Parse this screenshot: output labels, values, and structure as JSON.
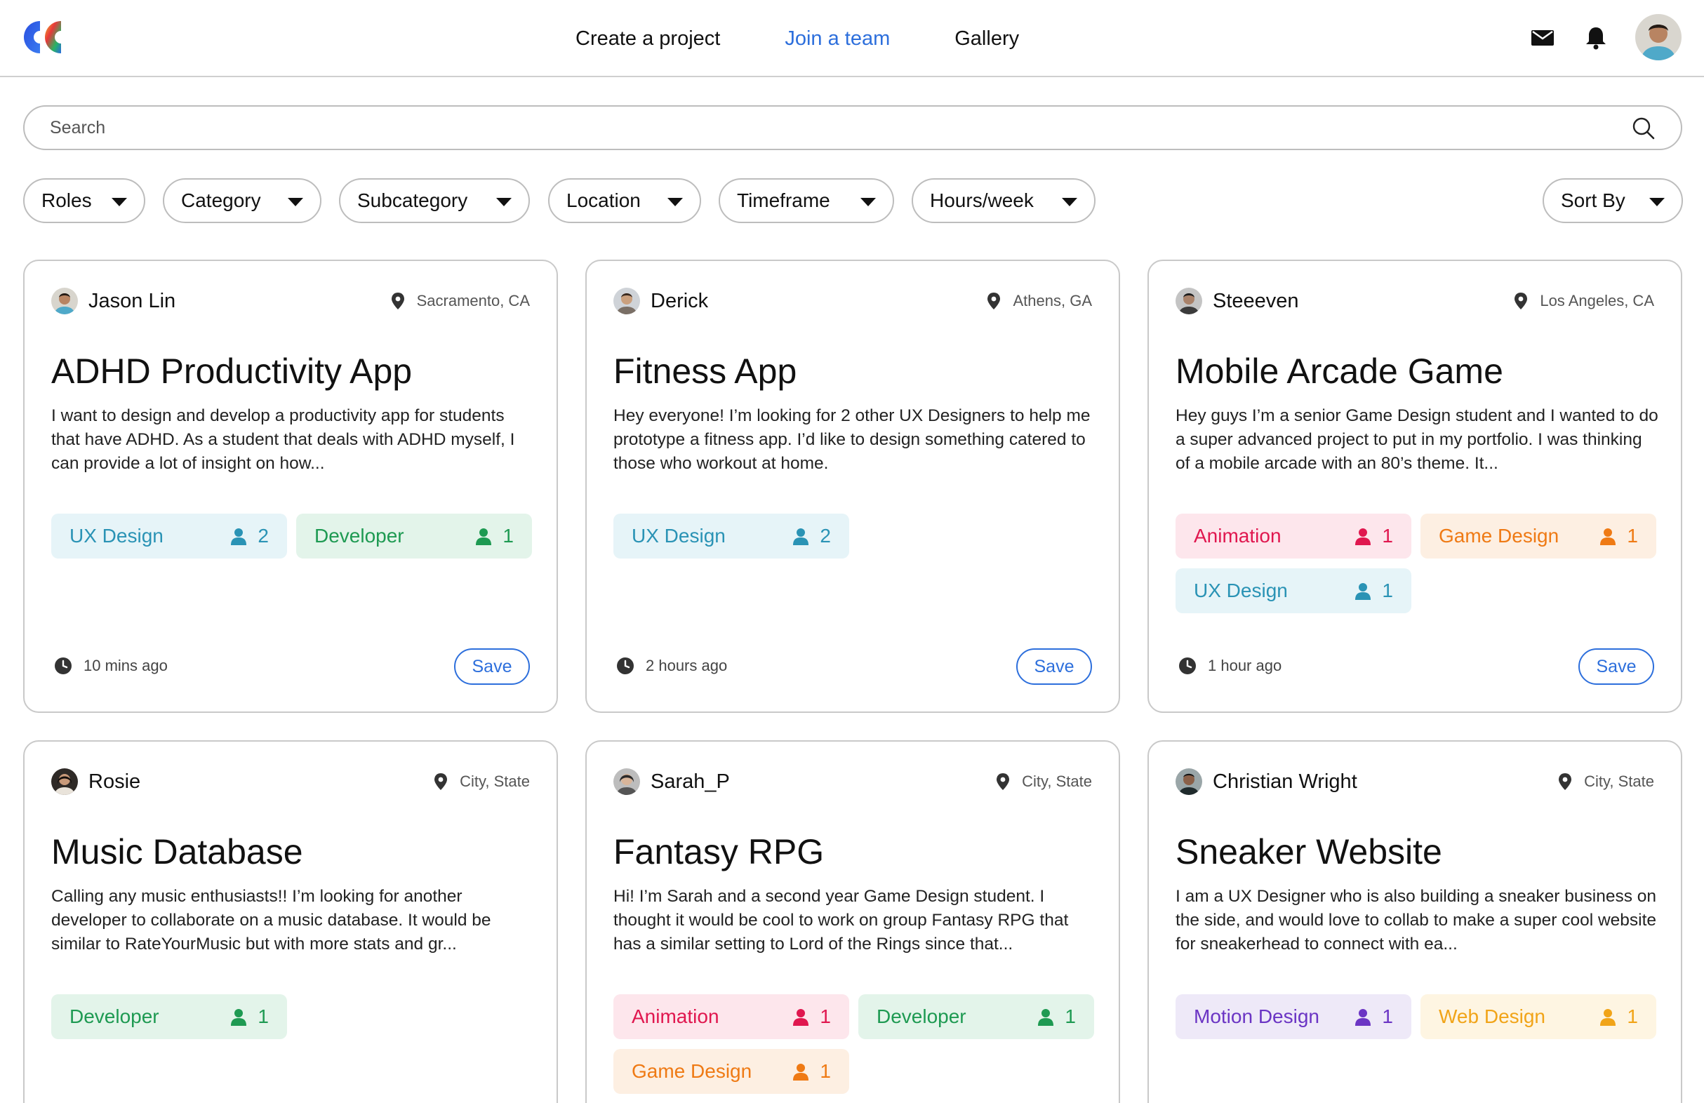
{
  "nav": {
    "items": [
      {
        "label": "Create a project",
        "active": false
      },
      {
        "label": "Join a team",
        "active": true
      },
      {
        "label": "Gallery",
        "active": false
      }
    ]
  },
  "search": {
    "placeholder": "Search"
  },
  "filters": [
    "Roles",
    "Category",
    "Subcategory",
    "Location",
    "Timeframe",
    "Hours/week"
  ],
  "sort": {
    "label": "Sort By"
  },
  "tag_colors": {
    "UX Design": "#2a93b5",
    "Developer": "#1e9a52",
    "Animation": "#e0174f",
    "Game Design": "#ef7a14",
    "Motion Design": "#6b35c4",
    "Web Design": "#f1a418"
  },
  "save_label": "Save",
  "cards": [
    {
      "owner": "Jason Lin",
      "location": "Sacramento, CA",
      "title": "ADHD Productivity App",
      "description": "I want to design and develop a productivity app for students that have ADHD. As a student that deals with ADHD myself, I can provide a lot of insight on how...",
      "tags": [
        {
          "label": "UX Design",
          "count": "2"
        },
        {
          "label": "Developer",
          "count": "1"
        }
      ],
      "time": "10 mins ago"
    },
    {
      "owner": "Derick",
      "location": "Athens, GA",
      "title": "Fitness App",
      "description": "Hey everyone! I’m looking for 2 other UX Designers to help me prototype a fitness app. I’d like to design something catered to those who workout at home.",
      "tags": [
        {
          "label": "UX Design",
          "count": "2"
        }
      ],
      "time": "2 hours ago"
    },
    {
      "owner": "Steeeven",
      "location": "Los Angeles, CA",
      "title": "Mobile Arcade Game",
      "description": "Hey guys I’m a senior Game Design student and I wanted to do a super advanced project to put in my portfolio. I was thinking of a mobile arcade with an 80’s theme. It...",
      "tags": [
        {
          "label": "Animation",
          "count": "1"
        },
        {
          "label": "Game Design",
          "count": "1"
        },
        {
          "label": "UX Design",
          "count": "1"
        }
      ],
      "time": "1 hour ago"
    },
    {
      "owner": "Rosie",
      "location": "City, State",
      "title": "Music Database",
      "description": "Calling any music enthusiasts!! I’m looking for another developer to collaborate on a music database. It would be similar to RateYourMusic but with more stats and gr...",
      "tags": [
        {
          "label": "Developer",
          "count": "1"
        }
      ],
      "time": ""
    },
    {
      "owner": "Sarah_P",
      "location": "City, State",
      "title": "Fantasy RPG",
      "description": "Hi! I’m Sarah and a second year Game Design student. I thought it would be cool to work on group Fantasy RPG that has a similar setting to Lord of the Rings since that...",
      "tags": [
        {
          "label": "Animation",
          "count": "1"
        },
        {
          "label": "Developer",
          "count": "1"
        },
        {
          "label": "Game Design",
          "count": "1"
        }
      ],
      "time": ""
    },
    {
      "owner": "Christian Wright",
      "location": "City, State",
      "title": "Sneaker Website",
      "description": "I am a UX Designer who is also building a sneaker business on the side, and would love to collab to make a super cool website for sneakerhead to connect with ea...",
      "tags": [
        {
          "label": "Motion Design",
          "count": "1"
        },
        {
          "label": "Web Design",
          "count": "1"
        }
      ],
      "time": ""
    }
  ]
}
